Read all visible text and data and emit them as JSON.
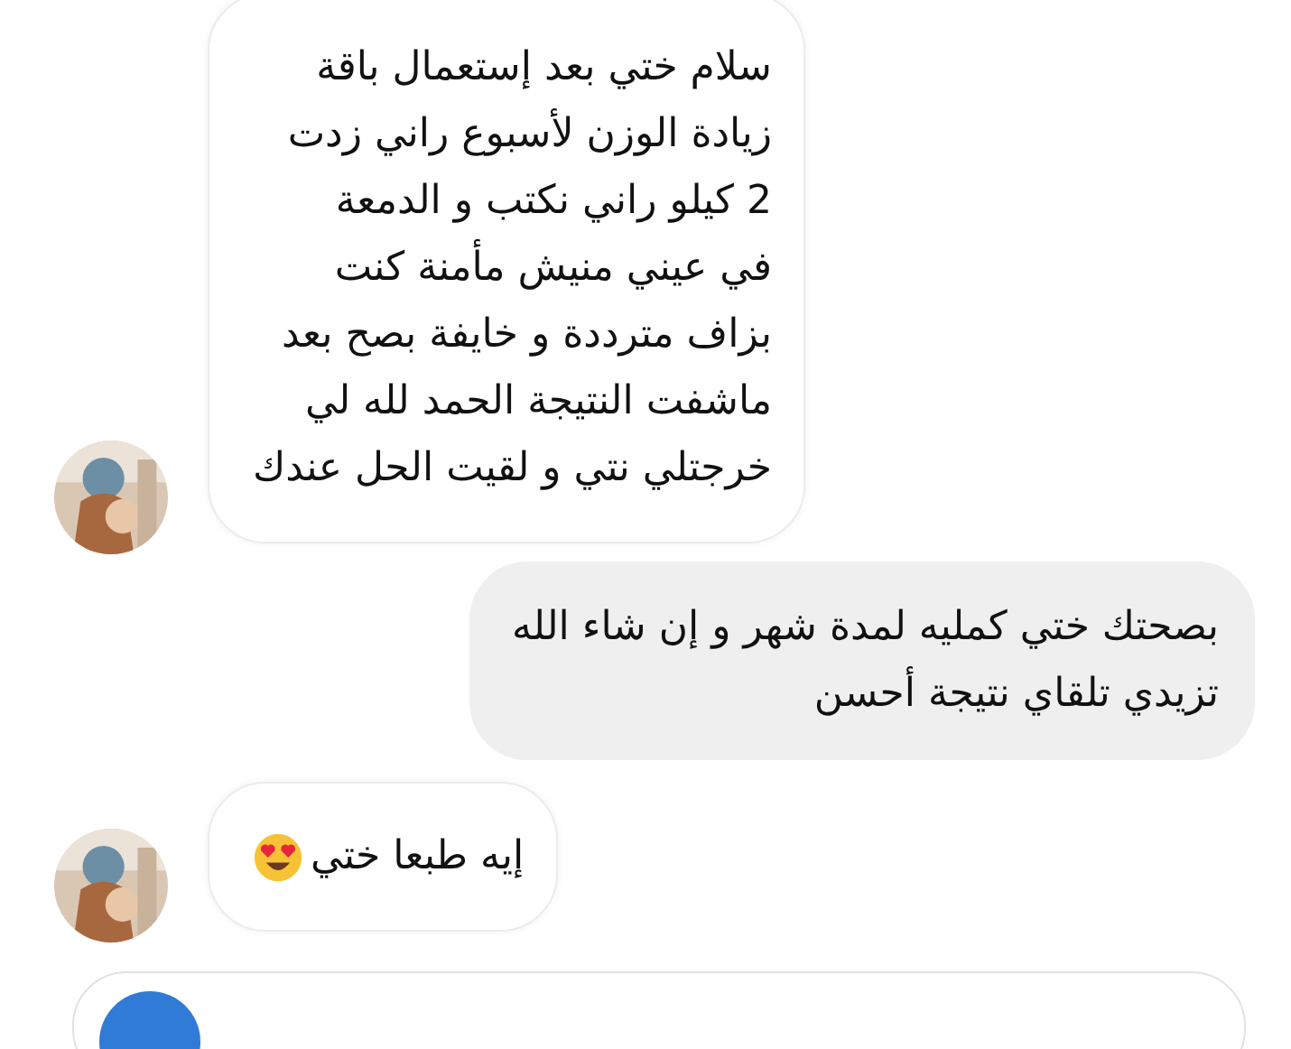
{
  "messages": [
    {
      "kind": "incoming",
      "lines": [
        "سلام ختي بعد إستعمال باقة",
        "زيادة الوزن لأسبوع راني زدت",
        "2 كيلو راني نكتب و الدمعة",
        "في عيني منيش مأمنة كنت",
        "بزاف مترددة و خايفة بصح بعد",
        "ماشفت النتيجة الحمد لله لي",
        "خرجتلي نتي و لقيت الحل عندك"
      ]
    },
    {
      "kind": "outgoing",
      "lines": [
        "بصحتك ختي كمليه لمدة شهر و إن شاء الله",
        "تزيدي تلقاي نتيجة أحسن"
      ]
    },
    {
      "kind": "incoming",
      "lines": [
        "إيه طبعا ختي"
      ],
      "emoji": true
    },
    {
      "kind": "cut_off"
    }
  ]
}
